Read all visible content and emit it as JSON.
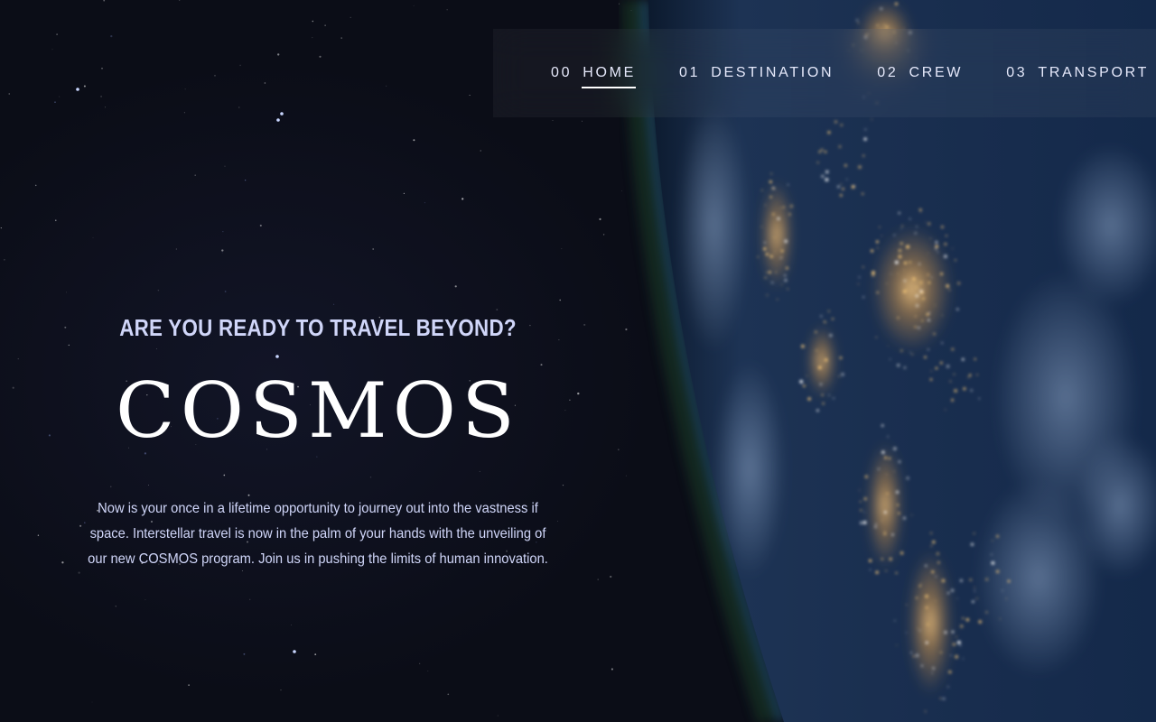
{
  "nav": {
    "items": [
      {
        "num": "00",
        "label": "HOME",
        "active": true
      },
      {
        "num": "01",
        "label": "DESTINATION",
        "active": false
      },
      {
        "num": "02",
        "label": "CREW",
        "active": false
      },
      {
        "num": "03",
        "label": "TRANSPORT",
        "active": false
      }
    ]
  },
  "hero": {
    "subtitle": "ARE YOU READY TO TRAVEL BEYOND?",
    "title": "COSMOS",
    "body": "Now is your once in a lifetime opportunity to journey out into the vastness if space. Interstellar travel is now in the palm of your hands with the unveiling of our new COSMOS program. Join us in pushing the limits of human innovation."
  },
  "colors": {
    "background": "#0b0d17",
    "text_light": "#d0d6f9",
    "white": "#ffffff",
    "city_lights": "#ffce7a"
  }
}
